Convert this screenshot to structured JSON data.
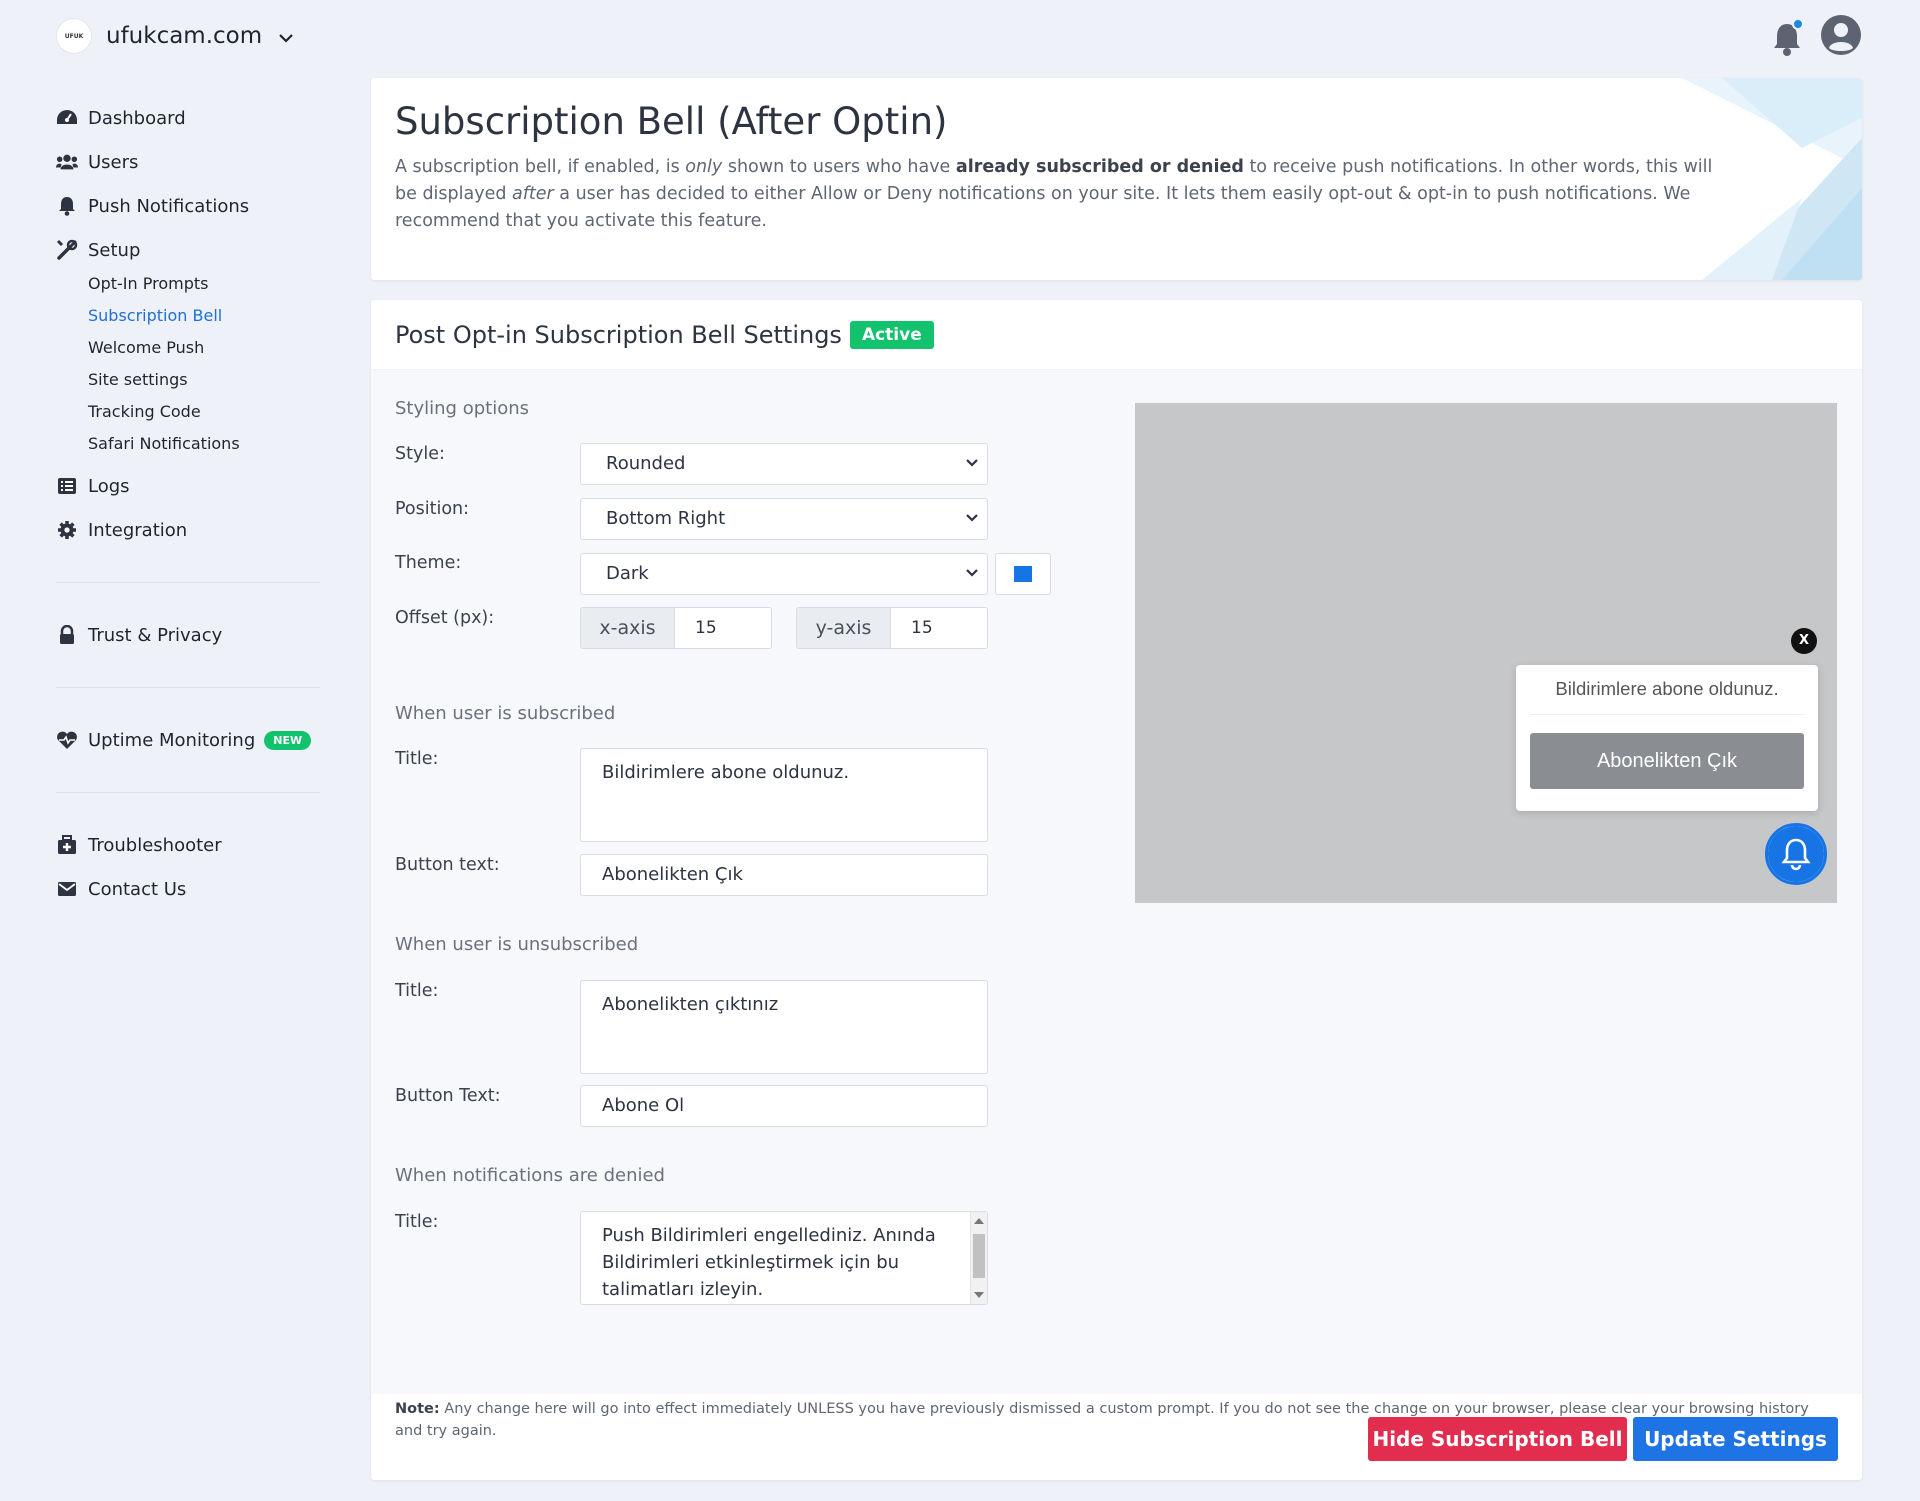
{
  "site": {
    "name": "ufukcam.com",
    "logo_text": "UFUK"
  },
  "sidebar": {
    "items": [
      {
        "label": "Dashboard",
        "icon": "dashboard-icon"
      },
      {
        "label": "Users",
        "icon": "users-icon"
      },
      {
        "label": "Push Notifications",
        "icon": "bell-icon"
      },
      {
        "label": "Setup",
        "icon": "tools-icon"
      }
    ],
    "setup_sub": [
      {
        "label": "Opt-In Prompts"
      },
      {
        "label": "Subscription Bell",
        "active": true
      },
      {
        "label": "Welcome Push"
      },
      {
        "label": "Site settings"
      },
      {
        "label": "Tracking Code"
      },
      {
        "label": "Safari Notifications"
      }
    ],
    "items2": [
      {
        "label": "Logs",
        "icon": "list-icon"
      },
      {
        "label": "Integration",
        "icon": "gear-icon"
      }
    ],
    "trust": "Trust & Privacy",
    "uptime": "Uptime Monitoring",
    "new_badge": "NEW",
    "troubleshooter": "Troubleshooter",
    "contact": "Contact Us"
  },
  "header": {
    "title": "Subscription Bell (After Optin)",
    "desc_1": "A subscription bell, if enabled, is ",
    "desc_only": "only",
    "desc_2": " shown to users who have ",
    "desc_bold": "already subscribed or denied",
    "desc_3": " to receive push notifications. In other words, this will be displayed ",
    "desc_after": "after",
    "desc_4": " a user has decided to either Allow or Deny notifications on your site. It lets them easily opt-out & opt-in to push notifications. We recommend that you activate this feature."
  },
  "settings": {
    "title": "Post Opt-in Subscription Bell Settings",
    "status": "Active",
    "styling_label": "Styling options",
    "style_label": "Style:",
    "style_value": "Rounded",
    "position_label": "Position:",
    "position_value": "Bottom Right",
    "theme_label": "Theme:",
    "theme_value": "Dark",
    "theme_color": "#1674e5",
    "offset_label": "Offset (px):",
    "x_axis_label": "x-axis",
    "x_axis_value": "15",
    "y_axis_label": "y-axis",
    "y_axis_value": "15",
    "subscribed_label": "When user is subscribed",
    "sub_title_label": "Title:",
    "sub_title_value": "Bildirimlere abone oldunuz.",
    "sub_button_label": "Button text:",
    "sub_button_value": "Abonelikten Çık",
    "unsubscribed_label": "When user is unsubscribed",
    "unsub_title_label": "Title:",
    "unsub_title_value": "Abonelikten çıktınız",
    "unsub_button_label": "Button Text:",
    "unsub_button_value": "Abone Ol",
    "denied_label": "When notifications are denied",
    "denied_title_label": "Title:",
    "denied_title_value": "Push Bildirimleri engellediniz. Anında Bildirimleri etkinleştirmek için bu talimatları izleyin.",
    "note_bold": "Note:",
    "note_text": " Any change here will go into effect immediately UNLESS you have previously dismissed a custom prompt. If you do not see the change on your browser, please clear your browsing history and try again.",
    "hide_button": "Hide Subscription Bell",
    "update_button": "Update Settings"
  },
  "preview": {
    "close": "X",
    "title": "Bildirimlere abone oldunuz.",
    "button": "Abonelikten Çık"
  }
}
